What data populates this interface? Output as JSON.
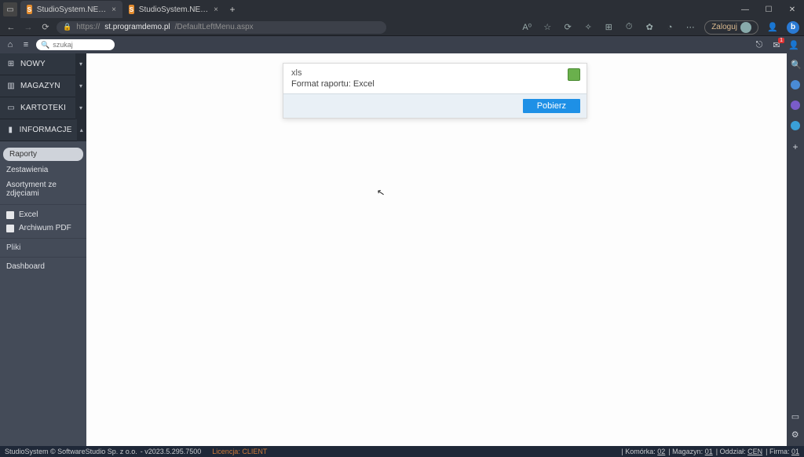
{
  "browser": {
    "tab1_title": "StudioSystem.NET (c) SoftwareS…",
    "tab2_title": "StudioSystem.NET (c) SoftwareS…",
    "url_prefix": "https://",
    "url_host": "st.programdemo.pl",
    "url_path": "/DefaultLeftMenu.aspx",
    "login_label": "Zaloguj",
    "bing_label": "b"
  },
  "app": {
    "search_placeholder": "szukaj",
    "nav": {
      "nowy": "NOWY",
      "magazyn": "MAGAZYN",
      "kartoteki": "KARTOTEKI",
      "informacje": "INFORMACJE"
    },
    "sub": {
      "raporty": "Raporty",
      "zestawienia": "Zestawienia",
      "asortyment": "Asortyment ze zdjęciami",
      "excel": "Excel",
      "archiwum": "Archiwum PDF",
      "pliki": "Pliki",
      "dashboard": "Dashboard"
    },
    "envelope_badge": "1"
  },
  "dialog": {
    "xls": "xls",
    "format_line": "Format raportu: Excel",
    "download": "Pobierz"
  },
  "status": {
    "copyright": "StudioSystem © SoftwareStudio Sp. z o.o.",
    "version": "- v2023.5.295.7500",
    "license": "Licencja: CLIENT",
    "komorka_label": "Komórka:",
    "komorka_val": "02",
    "magazyn_label": "Magazyn:",
    "magazyn_val": "01",
    "oddzial_label": "Oddział:",
    "oddzial_val": "CEN",
    "firma_label": "Firma:",
    "firma_val": "01"
  }
}
